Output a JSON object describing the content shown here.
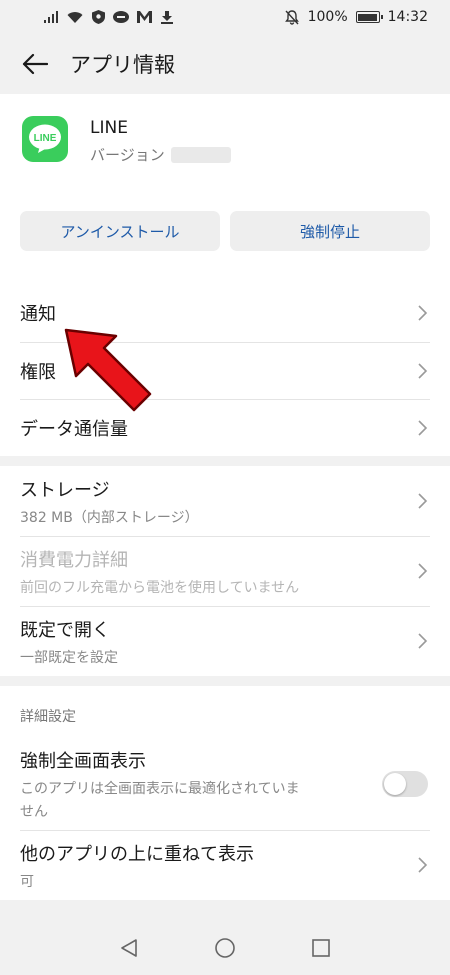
{
  "status_bar": {
    "battery_text": "100%",
    "time": "14:32",
    "left_icons": [
      "signal-icon",
      "wifi-icon",
      "vpn-shield-icon",
      "line-icon",
      "mail-icon",
      "download-icon"
    ],
    "right_icons": [
      "notification-off-icon",
      "battery-icon"
    ]
  },
  "header": {
    "title": "アプリ情報"
  },
  "app": {
    "name": "LINE",
    "icon_text": "LINE",
    "version_label": "バージョン",
    "brand_color": "#3acd5c"
  },
  "buttons": {
    "uninstall": "アンインストール",
    "force_stop": "強制停止",
    "text_color": "#1e5aa8"
  },
  "menu": {
    "notifications": "通知",
    "permissions": "権限",
    "data_usage": "データ通信量"
  },
  "storage_section": {
    "storage": {
      "label": "ストレージ",
      "sub": "382 MB（内部ストレージ）"
    },
    "power": {
      "label": "消費電力詳細",
      "sub": "前回のフル充電から電池を使用していません"
    },
    "default_open": {
      "label": "既定で開く",
      "sub": "一部既定を設定"
    }
  },
  "advanced": {
    "section_label": "詳細設定",
    "force_fullscreen": {
      "label": "強制全画面表示",
      "sub_line1": "このアプリは全画面表示に最適化されていま",
      "sub_line2": "せん",
      "enabled": false
    },
    "overlay": {
      "label": "他のアプリの上に重ねて表示",
      "sub": "可"
    }
  },
  "nav": {
    "icons": [
      "back-triangle-icon",
      "home-circle-icon",
      "recents-square-icon"
    ]
  },
  "annotation": {
    "arrow_color": "#e8141a"
  }
}
